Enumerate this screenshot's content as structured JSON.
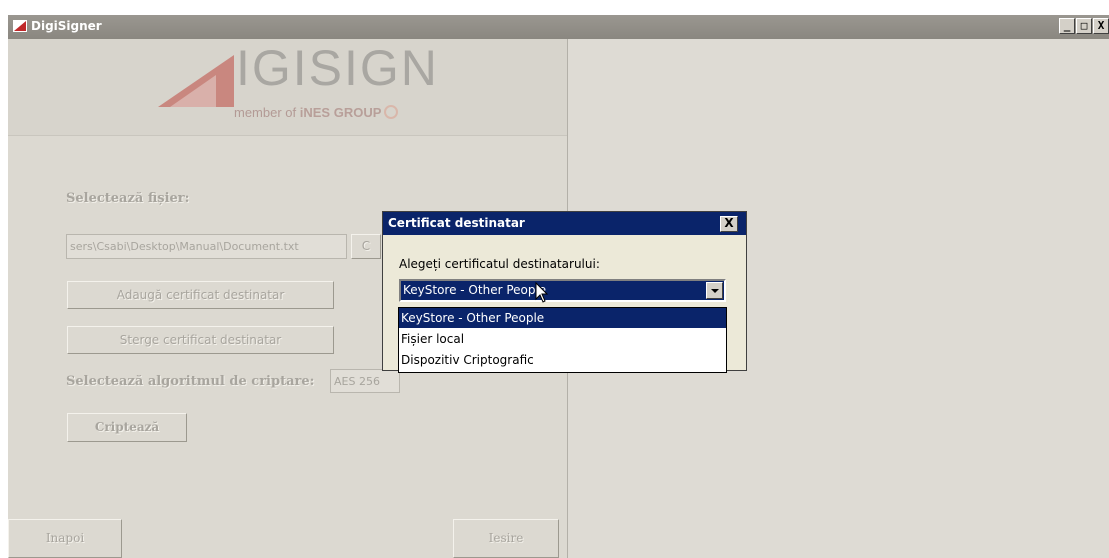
{
  "window": {
    "title": "DigiSigner",
    "minimize": "_",
    "maximize": "□",
    "close": "X"
  },
  "logo": {
    "word": "IGISIGN",
    "tag_prefix": "member of ",
    "tag_brand": "iNES GROUP"
  },
  "form": {
    "select_file_label": "Selectează fișier:",
    "file_path": "sers\\Csabi\\Desktop\\Manual\\Document.txt",
    "browse_button": "C",
    "add_cert_button": "Adaugă certificat destinatar",
    "remove_cert_button": "Sterge certificat destinatar",
    "algorithm_label": "Selectează algoritmul de criptare:",
    "algorithm_value": "AES 256",
    "encrypt_button": "Criptează",
    "back_button": "Inapoi",
    "exit_button": "Iesire"
  },
  "dialog": {
    "title": "Certificat destinatar",
    "close": "X",
    "prompt": "Alegeți certificatul destinatarului:",
    "selected": "KeyStore - Other People",
    "options": [
      "KeyStore - Other People",
      "Fișier local",
      "Dispozitiv Criptografic"
    ]
  },
  "colors": {
    "selection": "#0a246a",
    "window_bg": "#dedbd4",
    "logo_red": "#c96a64"
  }
}
